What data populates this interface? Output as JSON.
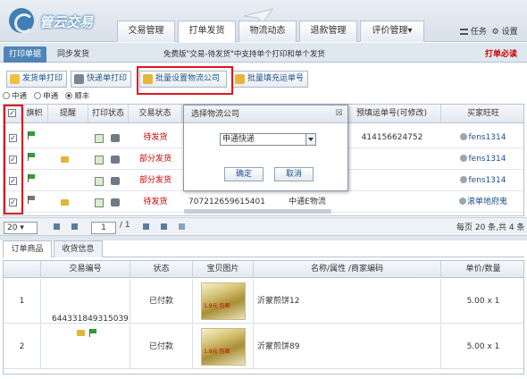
{
  "header": {
    "logo_text": "管云交易",
    "nav_tabs": [
      "交易管理",
      "打单发货",
      "物流动态",
      "退款管理",
      "评价管理▾"
    ],
    "active_tab_index": 1,
    "right_links": [
      "任务",
      "设置"
    ]
  },
  "subnav": {
    "tabs": [
      "打印单据",
      "同步发货"
    ],
    "notice": "免费版\"交易-待发货\"中支持单个打印和单个发货",
    "must_read": "打单必读"
  },
  "toolbar": {
    "buttons": [
      "发货单打印",
      "快递单打印",
      "批量设置物流公司",
      "批量填充运单号"
    ]
  },
  "carriers": {
    "options": [
      "中通",
      "申通",
      "顺丰"
    ],
    "selected_index": 2
  },
  "orders_grid": {
    "columns": [
      "",
      "旗帜",
      "提醒",
      "打印状态",
      "交易状态",
      "预填运单号(可修改)",
      "买家旺旺"
    ],
    "rows": [
      {
        "status": "待发货",
        "tracking": "414156624752",
        "buyer": "fens1314",
        "flag": "green"
      },
      {
        "status": "部分发货",
        "tracking": "",
        "buyer": "fens1314",
        "flag": "green"
      },
      {
        "status": "部分发货",
        "tracking": "",
        "buyer": "fens1314",
        "flag": "green"
      },
      {
        "status": "待发货",
        "tracking": "707212659615401",
        "carrier": "中通E物流",
        "buyer": "滚单地府鬼",
        "flag": "gray"
      }
    ]
  },
  "pager": {
    "page_size": "20",
    "page": "1",
    "total_pages": "/ 1",
    "summary": "每页 20 条,共 4 条"
  },
  "detail": {
    "tabs": [
      "订单商品",
      "收货信息"
    ],
    "columns": [
      "",
      "交易编号",
      "状态",
      "宝贝图片",
      "名称/属性 /商家编码",
      "单价/数量"
    ],
    "order_no": "644331849315039",
    "items": [
      {
        "index": "1",
        "status": "已付款",
        "name": "沂蒙煎饼12",
        "price": "5.00 x 1",
        "thumb_text": "1.9元  包邮"
      },
      {
        "index": "2",
        "status": "已付款",
        "name": "沂蒙煎饼89",
        "price": "5.00 x 1",
        "thumb_text": "1.9元  包邮"
      }
    ]
  },
  "dialog": {
    "title": "选择物流公司",
    "close": "☒",
    "selected": "申通快递",
    "ok": "确定",
    "cancel": "取消"
  },
  "colors": {
    "highlight": "#e0141e",
    "status_red": "#d40000",
    "accent": "#4f84b8"
  }
}
